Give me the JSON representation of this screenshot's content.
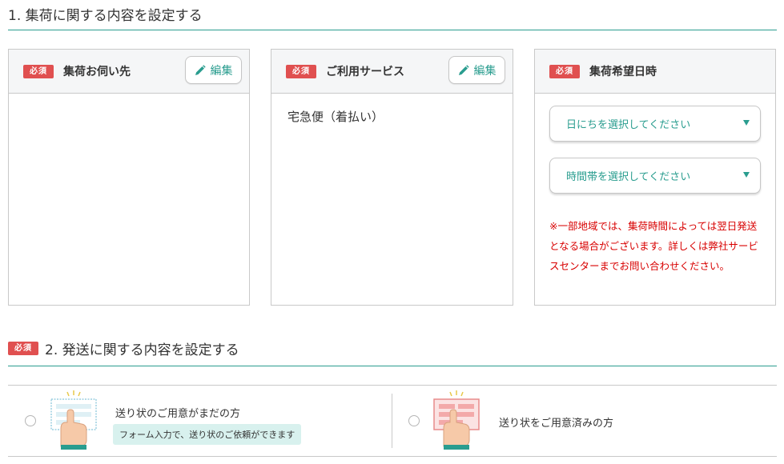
{
  "section1": {
    "title": "1. 集荷に関する内容を設定する"
  },
  "required_label": "必須",
  "panels": [
    {
      "label": "集荷お伺い先",
      "edit_label": "編集"
    },
    {
      "label": "ご利用サービス",
      "edit_label": "編集",
      "value": "宅急便（着払い）"
    },
    {
      "label": "集荷希望日時"
    }
  ],
  "pickup_time": {
    "date_placeholder": "日にちを選択してください",
    "time_placeholder": "時間帯を選択してください",
    "notice": "※一部地域では、集荷時間によっては翌日発送となる場合がございます。詳しくは弊社サービスセンターまでお問い合わせください。"
  },
  "section2": {
    "title": "2. 発送に関する内容を設定する"
  },
  "shipping_options": [
    {
      "label": "送り状のご用意がまだの方",
      "tag": "フォーム入力で、送り状のご依頼ができます"
    },
    {
      "label": "送り状をご用意済みの方"
    }
  ],
  "colors": {
    "accent": "#2a9d8f",
    "required": "#e05050",
    "notice": "#d80000"
  }
}
